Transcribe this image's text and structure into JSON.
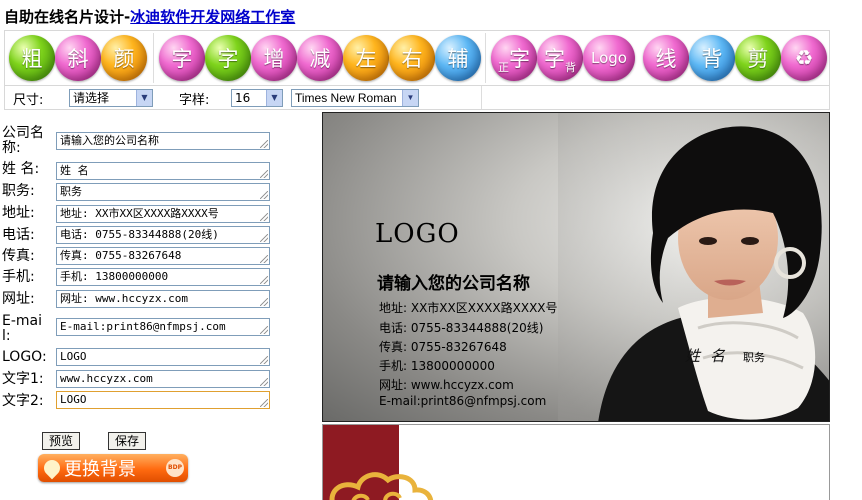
{
  "header": {
    "title": "自助在线名片设计-",
    "link": "冰迪软件开发网络工作室"
  },
  "toolbar": {
    "bold": "粗",
    "italic": "斜",
    "color": "颜",
    "char_left": "字",
    "char_right": "字",
    "increase": "增",
    "decrease": "减",
    "align_left": "左",
    "align_right": "右",
    "grid": "辅",
    "text_front_pre": "正",
    "text_front": "字",
    "text_back": "字",
    "text_back_sub": "背",
    "logo": "Logo",
    "line": "线",
    "bg": "背",
    "cut": "剪",
    "recycle": "♻",
    "colors": {
      "green": "#5cb814",
      "pink": "#e04cc0",
      "orange": "#ffa414",
      "blue": "#3d92dc"
    }
  },
  "options": {
    "size_label": "尺寸:",
    "size_value": "请选择",
    "font_label": "字样:",
    "font_size_value": "16",
    "font_family_value": "Times New Roman"
  },
  "form": {
    "company_label": "公司名称:",
    "company_value": "请输入您的公司名称",
    "name_label": "姓 名:",
    "name_value": "姓 名",
    "position_label": "职务:",
    "position_value": "职务",
    "address_label": "地址:",
    "address_value": "地址: XX市XX区XXXX路XXXX号",
    "phone_label": "电话:",
    "phone_value": "电话: 0755-83344888(20线)",
    "fax_label": "传真:",
    "fax_value": "传真: 0755-83267648",
    "mobile_label": "手机:",
    "mobile_value": "手机: 13800000000",
    "web_label": "网址:",
    "web_value": "网址: www.hccyzx.com",
    "email_label": "E-mail:",
    "email_value": "E-mail:print86@nfmpsj.com",
    "logo_label": "LOGO:",
    "logo_value": "LOGO",
    "text1_label": "文字1:",
    "text1_value": "www.hccyzx.com",
    "text2_label": "文字2:",
    "text2_value": "LOGO"
  },
  "buttons": {
    "preview": "预览",
    "save": "保存",
    "change_bg": "更换背景",
    "change_bg_badge": "BDP"
  },
  "card": {
    "logo": "LOGO",
    "company": "请输入您的公司名称",
    "address": "地址: XX市XX区XXXX路XXXX号",
    "phone": "电话: 0755-83344888(20线)",
    "fax": "传真: 0755-83267648",
    "mobile": "手机: 13800000000",
    "web": "网址: www.hccyzx.com",
    "email": "E-mail:print86@nfmpsj.com",
    "name": "姓名",
    "position": "职务"
  }
}
